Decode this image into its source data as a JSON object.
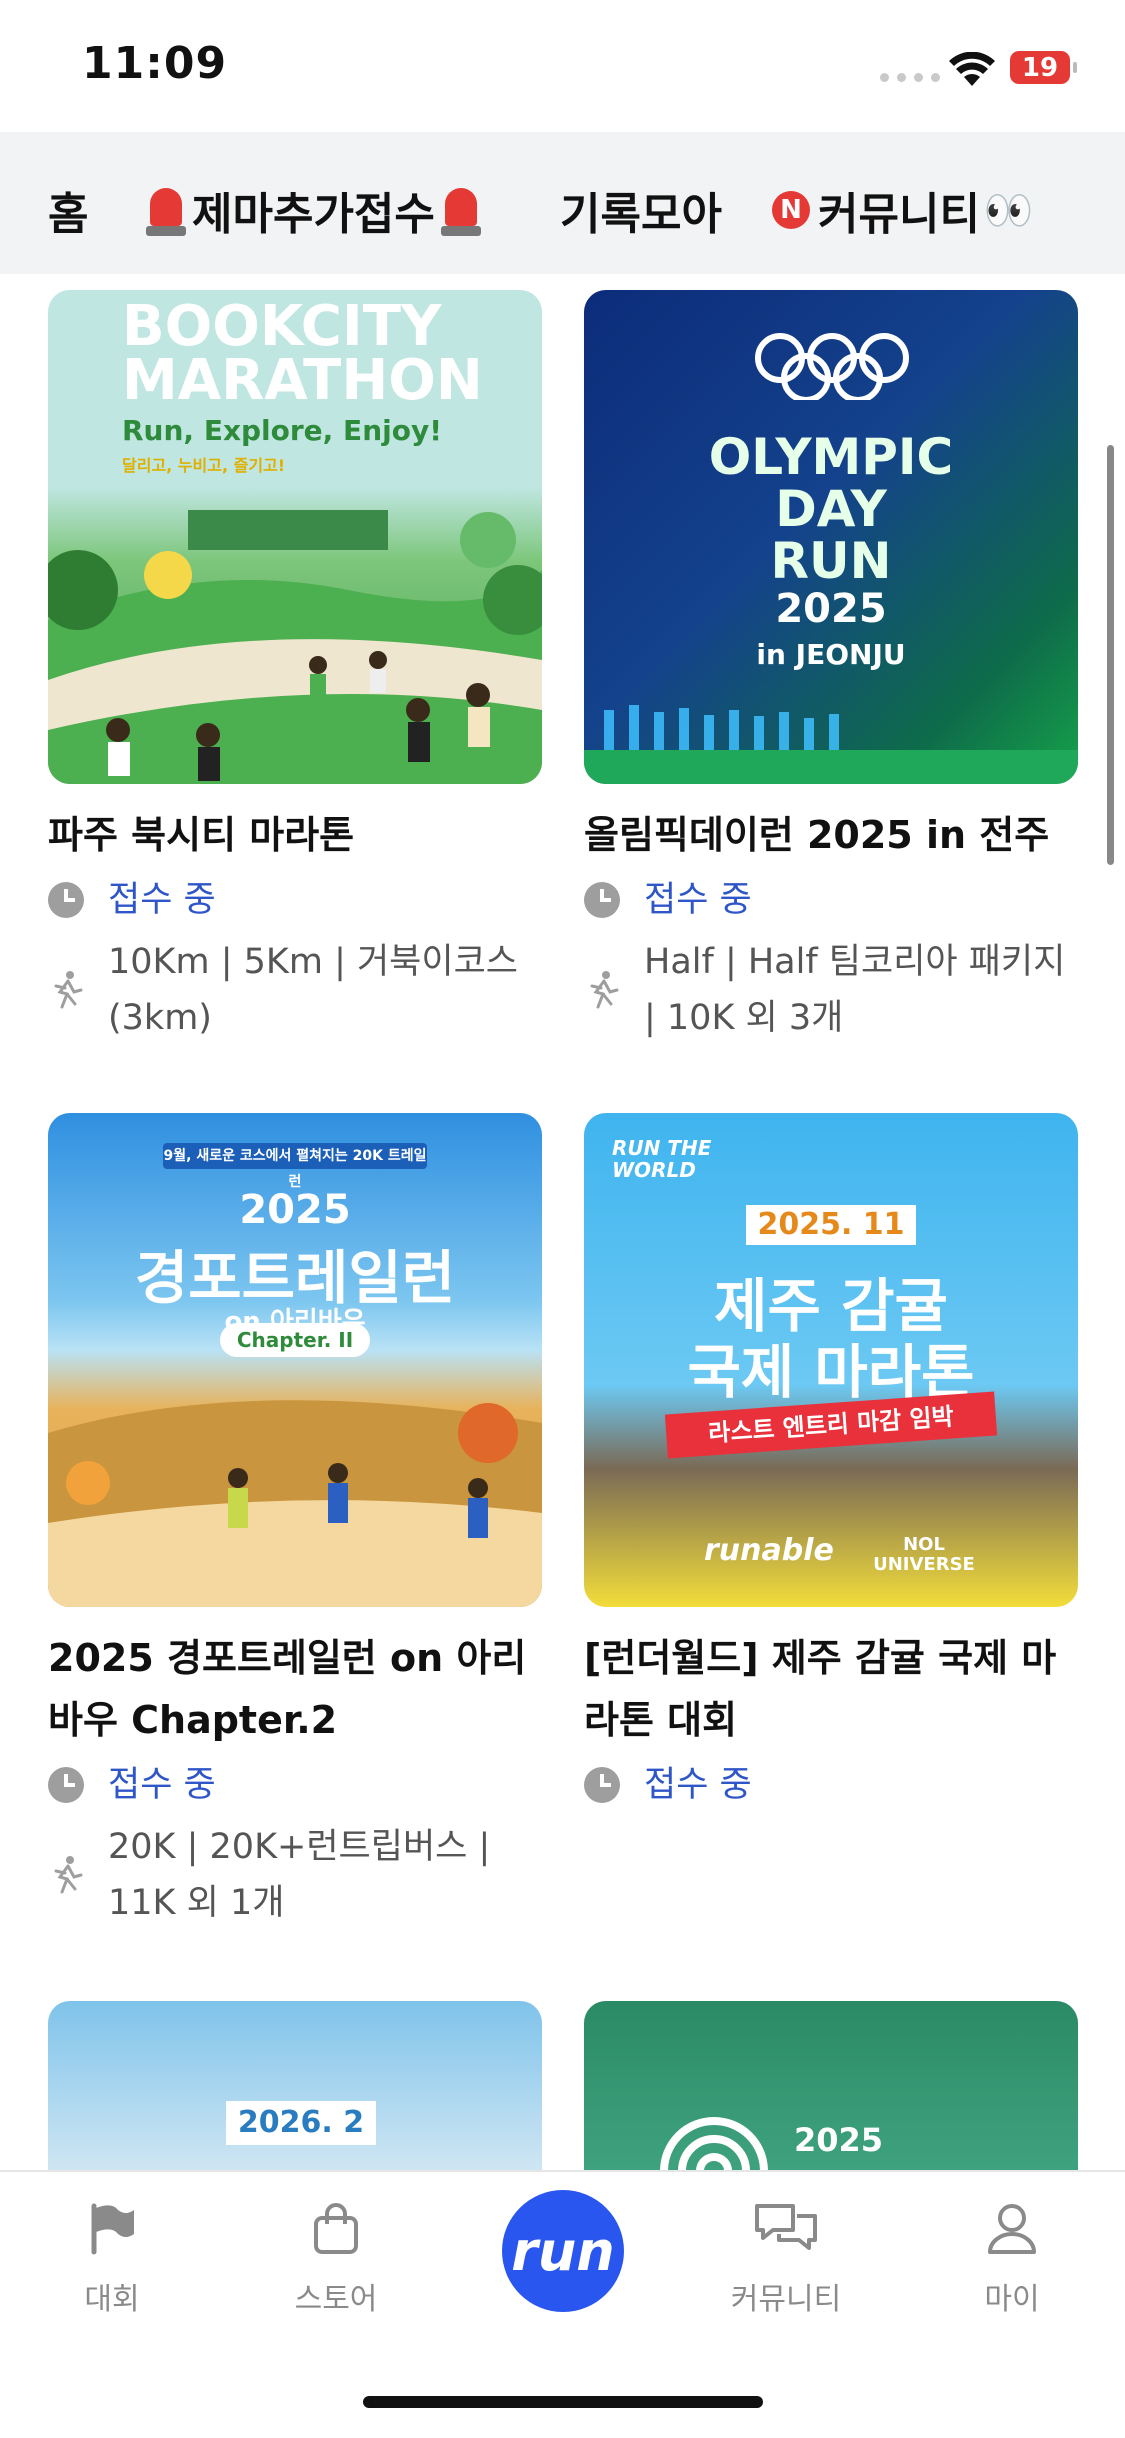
{
  "status_bar": {
    "time": "11:09",
    "battery": "19"
  },
  "top_tabs": [
    {
      "label": "홈"
    },
    {
      "label": "제마추가접수"
    },
    {
      "label": "기록모아"
    },
    {
      "label": "커뮤니티"
    }
  ],
  "nbadge": "N",
  "cards": [
    {
      "title": "파주 북시티 마라톤",
      "status": "접수 중",
      "distances": "10Km | 5Km | 거북이코스(3km)",
      "poster": {
        "line1": "BOOKCITY",
        "line2": "MARATHON",
        "tagline": "Run, Explore, Enjoy!",
        "sub": "달리고, 누비고, 즐기고!"
      }
    },
    {
      "title": "올림픽데이런 2025 in 전주",
      "status": "접수 중",
      "distances": "Half | Half 팀코리아 패키지 | 10K 외 3개",
      "poster": {
        "line1": "OLYMPIC",
        "line2": "DAY",
        "line3": "RUN",
        "year": "2025",
        "place": "in JEONJU"
      }
    },
    {
      "title": "2025 경포트레일런 on 아리바우 Chapter.2",
      "status": "접수 중",
      "distances": "20K | 20K+런트립버스 | 11K 외 1개",
      "poster": {
        "banner": "9월, 새로운 코스에서 펼쳐지는 20K 트레일런",
        "year": "2025",
        "name": "경포트레일런",
        "on": "on 아리바우",
        "chapter": "Chapter. II"
      }
    },
    {
      "title": "[런더월드] 제주 감귤 국제 마라톤 대회",
      "status": "접수 중",
      "distances": "",
      "poster": {
        "brand": "RUN THE WORLD",
        "date": "2025. 11",
        "name1": "제주 감귤",
        "name2": "국제 마라톤",
        "ribbon": "라스트 엔트리 마감 임박",
        "logo1": "runable",
        "logo2": "NOL UNIVERSE"
      }
    }
  ],
  "partial_cards": [
    {
      "poster_text": "2026. 2"
    },
    {
      "poster_text": "2025"
    }
  ],
  "bottom_nav": [
    {
      "label": "대회",
      "icon": "flag-icon"
    },
    {
      "label": "스토어",
      "icon": "bag-icon"
    },
    {
      "label": "run",
      "icon": "run-logo"
    },
    {
      "label": "커뮤니티",
      "icon": "chat-icon"
    },
    {
      "label": "마이",
      "icon": "person-icon"
    }
  ],
  "colors": {
    "accent": "#2a56f0",
    "status_blue": "#2f56c8",
    "tab_bg": "#f2f3f5"
  }
}
